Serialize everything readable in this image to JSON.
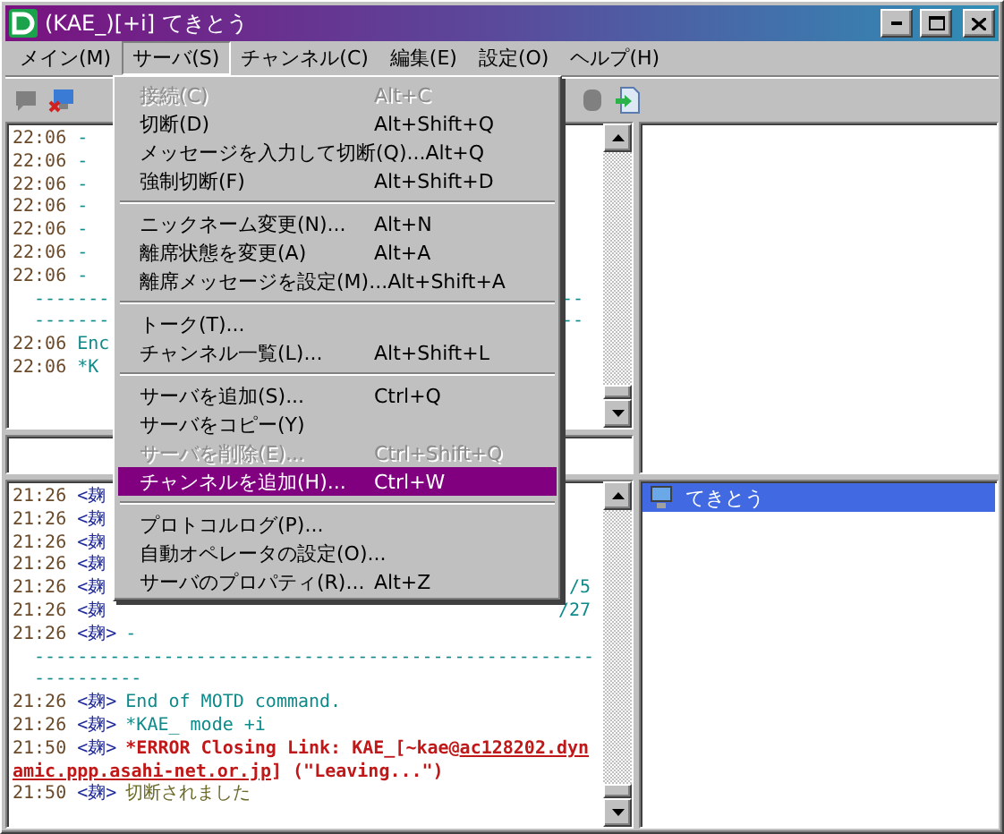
{
  "window": {
    "title": "(KAE_)[+i] てきとう"
  },
  "menu_bar": [
    {
      "label": "メイン(M)",
      "selected": false
    },
    {
      "label": "サーバ(S)",
      "selected": true
    },
    {
      "label": "チャンネル(C)",
      "selected": false
    },
    {
      "label": "編集(E)",
      "selected": false
    },
    {
      "label": "設定(O)",
      "selected": false
    },
    {
      "label": "ヘルプ(H)",
      "selected": false
    }
  ],
  "open_menu": {
    "items": [
      {
        "kind": "item",
        "label": "接続(C)",
        "shortcut": "Alt+C",
        "disabled": true,
        "selected": false
      },
      {
        "kind": "item",
        "label": "切断(D)",
        "shortcut": "Alt+Shift+Q",
        "disabled": false,
        "selected": false
      },
      {
        "kind": "item",
        "label": "メッセージを入力して切断(Q)...",
        "shortcut": "Alt+Q",
        "disabled": false,
        "selected": false
      },
      {
        "kind": "item",
        "label": "強制切断(F)",
        "shortcut": "Alt+Shift+D",
        "disabled": false,
        "selected": false
      },
      {
        "kind": "separator"
      },
      {
        "kind": "item",
        "label": "ニックネーム変更(N)...",
        "shortcut": "Alt+N",
        "disabled": false,
        "selected": false
      },
      {
        "kind": "item",
        "label": "離席状態を変更(A)",
        "shortcut": "Alt+A",
        "disabled": false,
        "selected": false
      },
      {
        "kind": "item",
        "label": "離席メッセージを設定(M)...",
        "shortcut": "Alt+Shift+A",
        "disabled": false,
        "selected": false
      },
      {
        "kind": "separator"
      },
      {
        "kind": "item",
        "label": "トーク(T)...",
        "disabled": false,
        "selected": false
      },
      {
        "kind": "item",
        "label": "チャンネル一覧(L)...",
        "shortcut": "Alt+Shift+L",
        "disabled": false,
        "selected": false
      },
      {
        "kind": "separator"
      },
      {
        "kind": "item",
        "label": "サーバを追加(S)...",
        "shortcut": "Ctrl+Q",
        "disabled": false,
        "selected": false
      },
      {
        "kind": "item",
        "label": "サーバをコピー(Y)",
        "disabled": false,
        "selected": false
      },
      {
        "kind": "item",
        "label": "サーバを削除(E)...",
        "shortcut": "Ctrl+Shift+Q",
        "disabled": true,
        "selected": false
      },
      {
        "kind": "item",
        "label": "チャンネルを追加(H)...",
        "shortcut": "Ctrl+W",
        "disabled": false,
        "selected": true
      },
      {
        "kind": "separator"
      },
      {
        "kind": "item",
        "label": "プロトコルログ(P)...",
        "disabled": false,
        "selected": false
      },
      {
        "kind": "item",
        "label": "自動オペレータの設定(O)...",
        "disabled": false,
        "selected": false
      },
      {
        "kind": "item",
        "label": "サーバのプロパティ(R)...",
        "shortcut": "Alt+Z",
        "disabled": false,
        "selected": false
      }
    ]
  },
  "top_log": {
    "lines": [
      {
        "kind": "message",
        "time": "22:06",
        "text": "-"
      },
      {
        "kind": "message",
        "time": "22:06",
        "text": "-"
      },
      {
        "kind": "message",
        "time": "22:06",
        "text": "-"
      },
      {
        "kind": "message",
        "time": "22:06",
        "text": "-"
      },
      {
        "kind": "message",
        "time": "22:06",
        "text": "-"
      },
      {
        "kind": "message",
        "time": "22:06",
        "text": "-"
      },
      {
        "kind": "message",
        "time": "22:06",
        "text": "-"
      },
      {
        "kind": "split_rule",
        "left": "-------",
        "right": "--"
      },
      {
        "kind": "split_rule",
        "left": "-------",
        "right": "--"
      },
      {
        "kind": "message",
        "time": "22:06",
        "text": "Enc"
      },
      {
        "kind": "message",
        "time": "22:06",
        "text": "*K"
      }
    ]
  },
  "bottom_log": {
    "lines": [
      {
        "kind": "message",
        "time": "21:26",
        "nick": "<麹"
      },
      {
        "kind": "message",
        "time": "21:26",
        "nick": "<麹"
      },
      {
        "kind": "message",
        "time": "21:26",
        "nick": "<麹"
      },
      {
        "kind": "message",
        "time": "21:26",
        "nick": "<麹"
      },
      {
        "kind": "message",
        "time": "21:26",
        "nick": "<麹",
        "tail": "/5"
      },
      {
        "kind": "message",
        "time": "21:26",
        "nick": "<麹",
        "tail": "/27"
      },
      {
        "kind": "message",
        "time": "21:26",
        "nick": "<麹>",
        "text": "-"
      },
      {
        "kind": "rule",
        "text": "----------------------------------------------------"
      },
      {
        "kind": "rule",
        "text": "----------"
      },
      {
        "kind": "message",
        "time": "21:26",
        "nick": "<麹>",
        "text": "End of MOTD command."
      },
      {
        "kind": "message",
        "time": "21:26",
        "nick": "<麹>",
        "text": "*KAE_ mode +i"
      },
      {
        "kind": "error",
        "time": "21:50",
        "nick": "<麹>",
        "text": "*ERROR Closing Link: KAE_[~kae@",
        "link": "ac128202.dynamic.ppp.asahi-net.or.jp",
        "after": "] (\"Leaving...\")"
      },
      {
        "kind": "notice",
        "time": "21:50",
        "nick": "<麹>",
        "text": "切断されました"
      }
    ]
  },
  "channel_list": {
    "items": [
      {
        "label": "てきとう",
        "selected": true
      }
    ]
  }
}
